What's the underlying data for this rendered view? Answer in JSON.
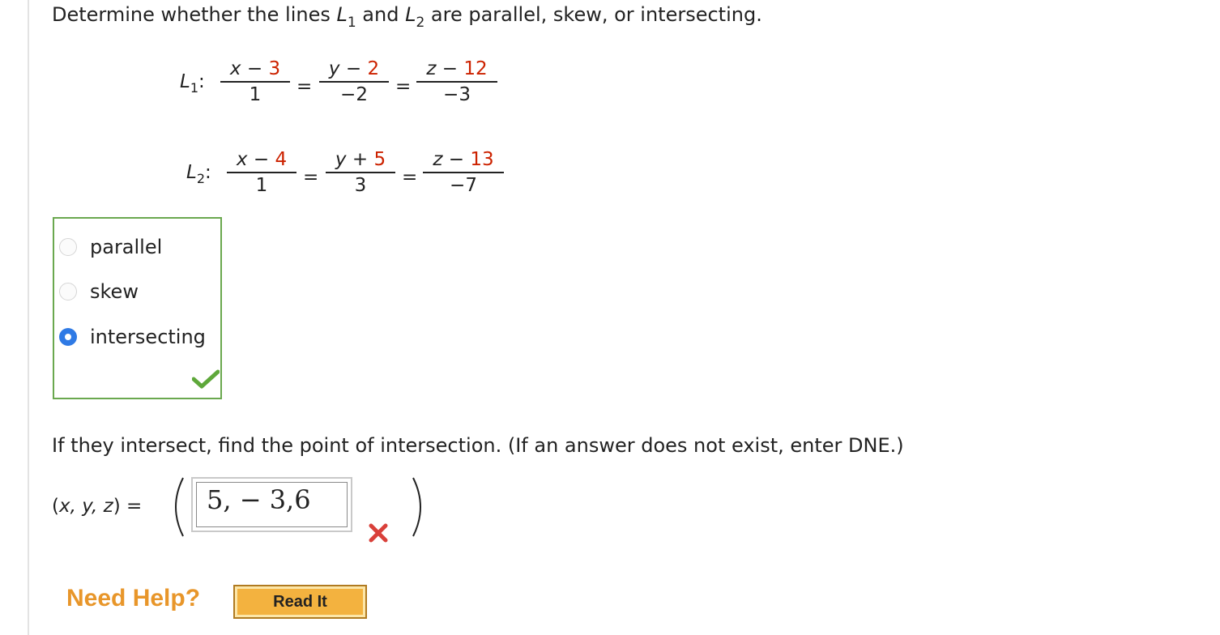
{
  "question": {
    "prefix": "Determine whether the lines ",
    "l1_letter": "L",
    "l1_sub": "1",
    "middle": " and ",
    "l2_letter": "L",
    "l2_sub": "2",
    "suffix": " are parallel, skew, or intersecting."
  },
  "line1": {
    "letter": "L",
    "sub": "1",
    "colon": ":",
    "terms": [
      {
        "var": "x",
        "op": "−",
        "const": "3",
        "den": "1"
      },
      {
        "var": "y",
        "op": "−",
        "const": "2",
        "den": "−2"
      },
      {
        "var": "z",
        "op": "−",
        "const": "12",
        "den": "−3"
      }
    ]
  },
  "line2": {
    "letter": "L",
    "sub": "2",
    "colon": ":",
    "terms": [
      {
        "var": "x",
        "op": "−",
        "const": "4",
        "den": "1"
      },
      {
        "var": "y",
        "op": "+",
        "const": "5",
        "den": "3"
      },
      {
        "var": "z",
        "op": "−",
        "const": "13",
        "den": "−7"
      }
    ]
  },
  "equals_sign": "=",
  "choices": {
    "options": [
      {
        "label": "parallel",
        "selected": false
      },
      {
        "label": "skew",
        "selected": false
      },
      {
        "label": "intersecting",
        "selected": true
      }
    ],
    "status_icon": "checkmark-icon",
    "border_color": "#6aa84f"
  },
  "sub_question": "If they intersect, find the point of intersection. (If an answer does not exist, enter DNE.)",
  "answer": {
    "label_open": "(",
    "label_vars": "x, y, z",
    "label_close": ")",
    "label_equals": " = ",
    "value": "5, − 3,6",
    "status_icon": "x-mark-icon"
  },
  "help": {
    "text": "Need Help?",
    "button_label": "Read It"
  },
  "colors": {
    "accent_red": "#cc2200",
    "help_orange": "#e8962a",
    "radio_blue": "#2f7ae5"
  }
}
